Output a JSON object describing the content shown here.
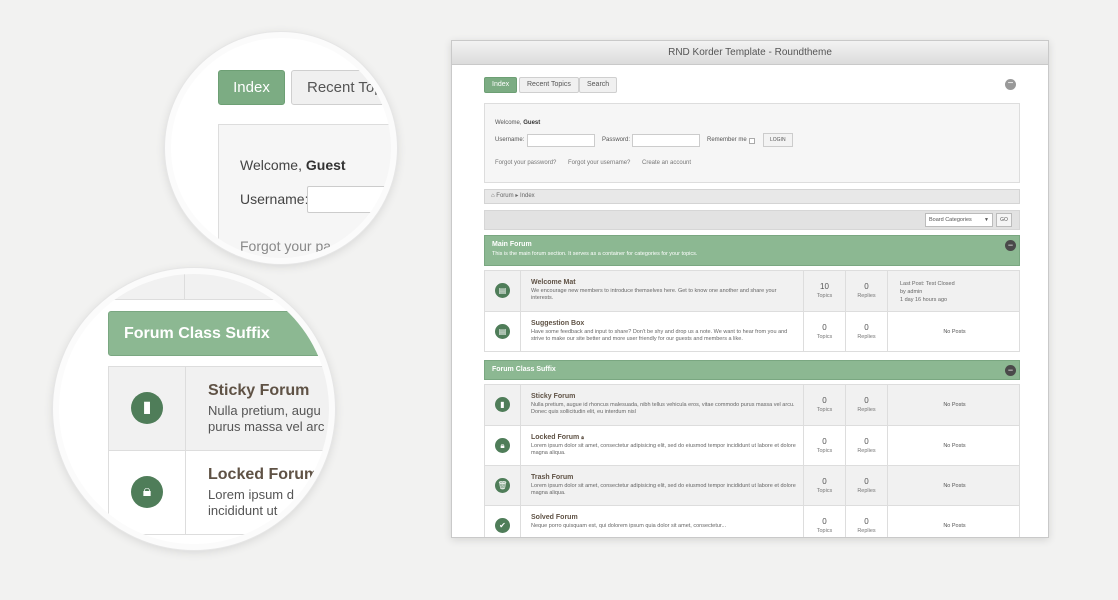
{
  "window": {
    "title": "RND Korder Template - Roundtheme"
  },
  "tabs": [
    {
      "label": "Index",
      "active": true
    },
    {
      "label": "Recent Topics",
      "active": false
    },
    {
      "label": "Search",
      "active": false
    }
  ],
  "login": {
    "welcome_prefix": "Welcome,",
    "welcome_user": "Guest",
    "username_label": "Username:",
    "password_label": "Password:",
    "remember_label": "Remember me",
    "login_button": "LOGIN",
    "forgot_password": "Forgot your password?",
    "forgot_username": "Forgot your username?",
    "create_account": "Create an account"
  },
  "breadcrumb": {
    "home": "Forum",
    "separator": "▸",
    "current": "Index"
  },
  "board_select": {
    "selected": "Board Categories",
    "go": "GO"
  },
  "categories": [
    {
      "title": "Main Forum",
      "desc": "This is the main forum section. It serves as a container for categories for your topics.",
      "forums": [
        {
          "title": "Welcome Mat",
          "desc": "We encourage new members to introduce themselves here. Get to know one another and share your interests.",
          "topics": "10",
          "replies": "0",
          "last": {
            "line1": "Last Post: Test Closed",
            "line2": "by admin",
            "line3": "1 day 16 hours ago"
          },
          "icon": "document-icon"
        },
        {
          "title": "Suggestion Box",
          "desc": "Have some feedback and input to share? Don't be shy and drop us a note. We want to hear from you and strive to make our site better and more user friendly for our guests and members a like.",
          "topics": "0",
          "replies": "0",
          "last": {
            "no_posts": "No Posts"
          },
          "icon": "document-icon"
        }
      ]
    },
    {
      "title": "Forum Class Suffix",
      "forums": [
        {
          "title": "Sticky Forum",
          "desc": "Nulla pretium, augue id rhoncus malesuada, nibh tellus vehicula eros, vitae commodo purus massa vel arcu. Donec quis sollicitudin elit, eu interdum nisl",
          "topics": "0",
          "replies": "0",
          "last": {
            "no_posts": "No Posts"
          },
          "icon": "bookmark-icon"
        },
        {
          "title": "Locked Forum",
          "desc": "Lorem ipsum dolor sit amet, consectetur adipisicing elit, sed do eiusmod tempor incididunt ut labore et dolore magna aliqua.",
          "topics": "0",
          "replies": "0",
          "last": {
            "no_posts": "No Posts"
          },
          "icon": "lock-icon"
        },
        {
          "title": "Trash Forum",
          "desc": "Lorem ipsum dolor sit amet, consectetur adipisicing elit, sed do eiusmod tempor incididunt ut labore et dolore magna aliqua.",
          "topics": "0",
          "replies": "0",
          "last": {
            "no_posts": "No Posts"
          },
          "icon": "trash-icon"
        },
        {
          "title": "Solved Forum",
          "desc": "Neque porro quisquam est, qui dolorem ipsum quia dolor sit amet, consectetur...",
          "topics": "0",
          "replies": "0",
          "last": {
            "no_posts": "No Posts"
          },
          "icon": "check-icon"
        }
      ]
    }
  ],
  "labels": {
    "topics": "Topics",
    "replies": "Replies"
  },
  "zoom_top": {
    "index": "Index",
    "recent": "Recent Top",
    "welcome_prefix": "Welcome,",
    "welcome_user": "Guest",
    "username": "Username:",
    "forgot": "Forgot your pa"
  },
  "zoom_bottom": {
    "header": "Forum Class Suffix",
    "rows": [
      {
        "title": "Sticky Forum",
        "line1": "Nulla pretium, augu",
        "line2": "purus massa vel arc",
        "icon": "bookmark-icon"
      },
      {
        "title": "Locked Forum",
        "line1": "Lorem ipsum d",
        "line2": "incididunt ut",
        "icon": "lock-icon"
      }
    ]
  },
  "colors": {
    "accent": "#7cac83",
    "category": "#8cb892",
    "icon": "#4f7d59"
  }
}
